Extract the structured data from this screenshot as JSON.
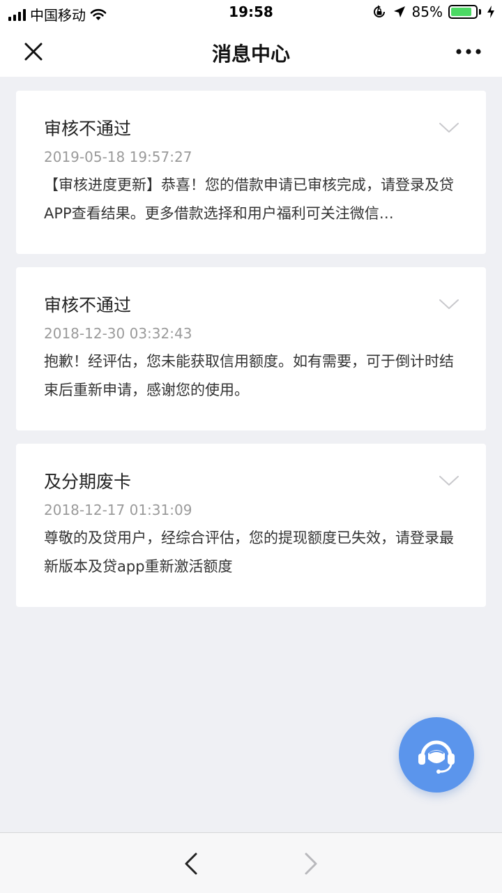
{
  "status_bar": {
    "carrier": "中国移动",
    "time": "19:58",
    "battery_percent": "85%",
    "battery_level": 0.85,
    "battery_color": "#4cd964"
  },
  "header": {
    "title": "消息中心",
    "close_icon": "close-icon",
    "more_icon": "more-icon"
  },
  "messages": [
    {
      "title": "审核不通过",
      "time": "2019-05-18 19:57:27",
      "body": "【审核进度更新】恭喜！您的借款申请已审核完成，请登录及贷APP查看结果。更多借款选择和用户福利可关注微信…"
    },
    {
      "title": "审核不通过",
      "time": "2018-12-30 03:32:43",
      "body": "抱歉！经评估，您未能获取信用额度。如有需要，可于倒计时结束后重新申请，感谢您的使用。"
    },
    {
      "title": "及分期废卡",
      "time": "2018-12-17 01:31:09",
      "body": "尊敬的及贷用户，经综合评估，您的提现额度已失效，请登录最新版本及贷app重新激活额度"
    }
  ],
  "service_button": {
    "icon": "customer-service-icon",
    "color": "#5b95ec"
  },
  "bottom_bar": {
    "back_icon": "chevron-left-icon",
    "forward_icon": "chevron-right-icon"
  }
}
